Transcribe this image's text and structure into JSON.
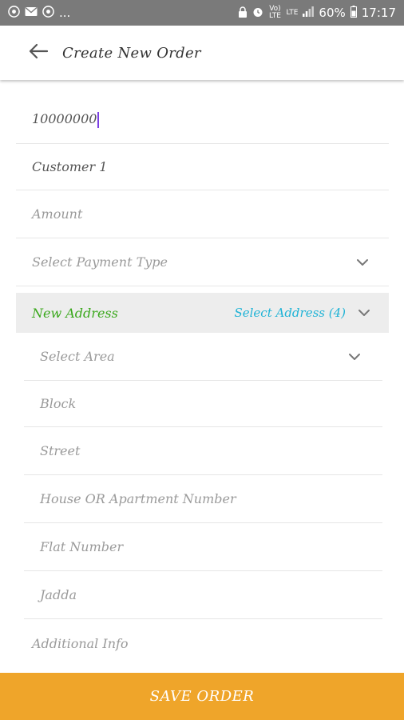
{
  "status_bar": {
    "left_icons": [
      "chrome-icon",
      "mail-icon",
      "chrome-icon"
    ],
    "overflow": "...",
    "battery": "60%",
    "time": "17:17",
    "volte": "Vo) LTE",
    "lte": "LTE"
  },
  "app_bar": {
    "title": "Create New Order"
  },
  "form": {
    "order_number": "10000000",
    "customer": "Customer 1",
    "amount_placeholder": "Amount",
    "payment_type_placeholder": "Select Payment Type",
    "new_address_label": "New Address",
    "select_address_label": "Select Address (4)",
    "area_placeholder": "Select Area",
    "block_placeholder": "Block",
    "street_placeholder": "Street",
    "house_placeholder": "House OR Apartment Number",
    "flat_placeholder": "Flat Number",
    "jadda_placeholder": "Jadda",
    "additional_info_placeholder": "Additional Info"
  },
  "save_button": {
    "label": "SAVE ORDER"
  },
  "colors": {
    "status_bar": "#7a7a7a",
    "accent_green": "#3aa81c",
    "accent_blue": "#1fb3d6",
    "save_button": "#efa52a",
    "caret": "#7b3fe4"
  }
}
